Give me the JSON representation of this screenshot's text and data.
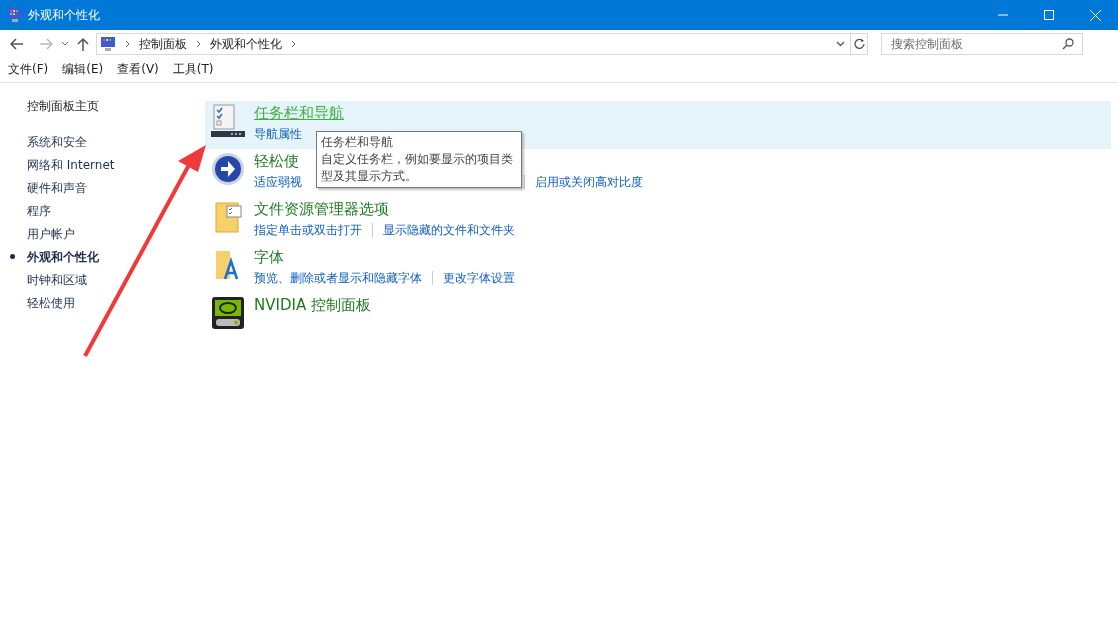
{
  "window": {
    "title": "外观和个性化"
  },
  "address": {
    "crumbs": [
      "控制面板",
      "外观和个性化"
    ],
    "search_placeholder": "搜索控制面板"
  },
  "menu": [
    "文件(F)",
    "编辑(E)",
    "查看(V)",
    "工具(T)"
  ],
  "sidebar": {
    "home": "控制面板主页",
    "items": [
      {
        "label": "系统和安全",
        "selected": false
      },
      {
        "label": "网络和 Internet",
        "selected": false
      },
      {
        "label": "硬件和声音",
        "selected": false
      },
      {
        "label": "程序",
        "selected": false
      },
      {
        "label": "用户帐户",
        "selected": false
      },
      {
        "label": "外观和个性化",
        "selected": true
      },
      {
        "label": "时钟和区域",
        "selected": false
      },
      {
        "label": "轻松使用",
        "selected": false
      }
    ]
  },
  "categories": [
    {
      "kind": "taskbar",
      "title": "任务栏和导航",
      "hovered": true,
      "links": [
        "导航属性"
      ]
    },
    {
      "kind": "ease",
      "title": "轻松使",
      "hovered": false,
      "links": [
        "适应弱视",
        "启用或关闭高对比度"
      ]
    },
    {
      "kind": "folder",
      "title": "文件资源管理器选项",
      "hovered": false,
      "links": [
        "指定单击或双击打开",
        "显示隐藏的文件和文件夹"
      ]
    },
    {
      "kind": "font",
      "title": "字体",
      "hovered": false,
      "links": [
        "预览、删除或者显示和隐藏字体",
        "更改字体设置"
      ]
    },
    {
      "kind": "nvidia",
      "title": "NVIDIA 控制面板",
      "hovered": false
    }
  ],
  "tooltip": {
    "title": "任务栏和导航",
    "lines": [
      "自定义任务栏，例如要显示的项目类",
      "型及其显示方式。"
    ]
  }
}
